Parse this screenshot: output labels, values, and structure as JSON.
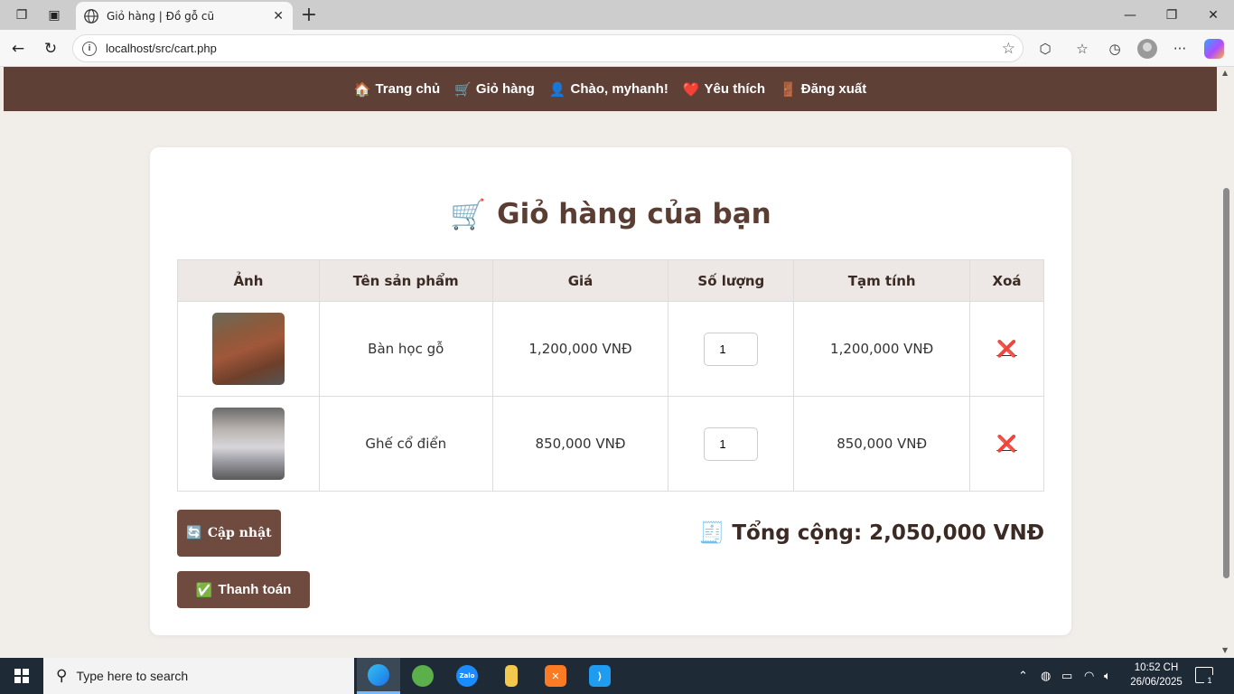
{
  "browser": {
    "tab_title": "Giỏ hàng | Đồ gỗ cũ",
    "url": "localhost/src/cart.php"
  },
  "site_nav": {
    "items": [
      {
        "emoji": "🏠",
        "label": "Trang chủ"
      },
      {
        "emoji": "🛒",
        "label": "Giỏ hàng"
      },
      {
        "emoji": "👤",
        "label": "Chào, myhanh!"
      },
      {
        "emoji": "❤️",
        "label": "Yêu thích"
      },
      {
        "emoji": "🚪",
        "label": "Đăng xuất"
      }
    ]
  },
  "cart": {
    "title_emoji": "🛒",
    "title": "Giỏ hàng của bạn",
    "columns": [
      "Ảnh",
      "Tên sản phẩm",
      "Giá",
      "Số lượng",
      "Tạm tính",
      "Xoá"
    ],
    "rows": [
      {
        "name": "Bàn học gỗ",
        "price": "1,200,000 VNĐ",
        "qty": "1",
        "subtotal": "1,200,000 VNĐ",
        "delete": "❌"
      },
      {
        "name": "Ghế cổ điển",
        "price": "850,000 VNĐ",
        "qty": "1",
        "subtotal": "850,000 VNĐ",
        "delete": "❌"
      }
    ],
    "update_emoji": "🔄",
    "update_label": "Cập nhật",
    "checkout_emoji": "✅",
    "checkout_label": "Thanh toán",
    "total_emoji": "🧾",
    "total_label": "Tổng cộng: 2,050,000 VNĐ"
  },
  "taskbar": {
    "search_placeholder": "Type here to search",
    "time": "10:52 CH",
    "date": "26/06/2025",
    "notification_count": "1"
  }
}
